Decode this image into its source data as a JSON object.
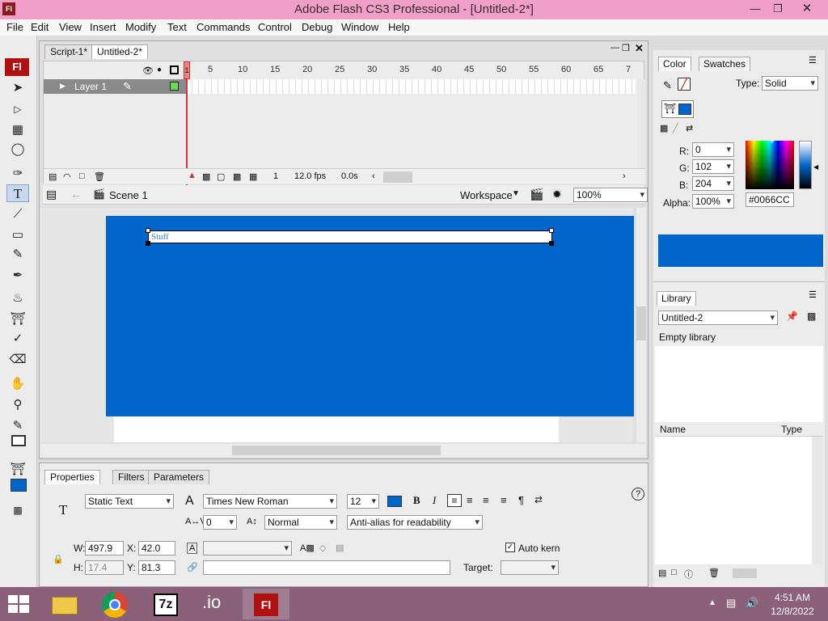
{
  "titlebar": {
    "app_icon": "Fl",
    "title": "Adobe Flash CS3 Professional - [Untitled-2*]"
  },
  "menu": [
    "File",
    "Edit",
    "View",
    "Insert",
    "Modify",
    "Text",
    "Commands",
    "Control",
    "Debug",
    "Window",
    "Help"
  ],
  "tools_logo": "Fl",
  "doc_tabs": [
    "Script-1*",
    "Untitled-2*"
  ],
  "timeline": {
    "layer_name": "Layer 1",
    "ruler": [
      "5",
      "10",
      "15",
      "20",
      "25",
      "30",
      "35",
      "40",
      "45",
      "50",
      "55",
      "60",
      "65",
      "7"
    ],
    "first_tick": "1",
    "current_frame": "1",
    "fps": "12.0 fps",
    "elapsed": "0.0s"
  },
  "editbar": {
    "scene": "Scene 1",
    "workspace": "Workspace",
    "zoom": "100%"
  },
  "stage": {
    "text": "Stuff"
  },
  "properties": {
    "tabs": [
      "Properties",
      "Filters",
      "Parameters"
    ],
    "text_type": "Static Text",
    "font": "Times New Roman",
    "size": "12",
    "letter_spacing": "0",
    "position_mode": "Normal",
    "antialias": "Anti-alias for readability",
    "w_label": "W:",
    "w": "497.9",
    "x_label": "X:",
    "x": "42.0",
    "h_label": "H:",
    "h": "17.4",
    "y_label": "Y:",
    "y": "81.3",
    "auto_kern_label": "Auto kern",
    "auto_kern": true,
    "target_label": "Target:",
    "text_color": "#0066CC"
  },
  "color_panel": {
    "tabs": [
      "Color",
      "Swatches"
    ],
    "type_label": "Type:",
    "type": "Solid",
    "r_label": "R:",
    "r": "0",
    "g_label": "G:",
    "g": "102",
    "b_label": "B:",
    "b": "204",
    "alpha_label": "Alpha:",
    "alpha": "100%",
    "hex": "#0066CC",
    "swatch_color": "#0066CC"
  },
  "library_panel": {
    "tab": "Library",
    "document": "Untitled-2",
    "status": "Empty library",
    "col_name": "Name",
    "col_type": "Type"
  },
  "taskbar": {
    "time": "4:51 AM",
    "date": "12/8/2022",
    "icons": [
      "file-explorer-icon",
      "chrome-icon",
      "7zip-icon",
      "io-icon",
      "flash-icon"
    ],
    "sevenzip": "7z",
    "flash": "Fl",
    "io": ".io"
  },
  "colors": {
    "stage": "#0066cc",
    "titlebar": "#f0a0c8",
    "taskbar": "#8a6178"
  }
}
